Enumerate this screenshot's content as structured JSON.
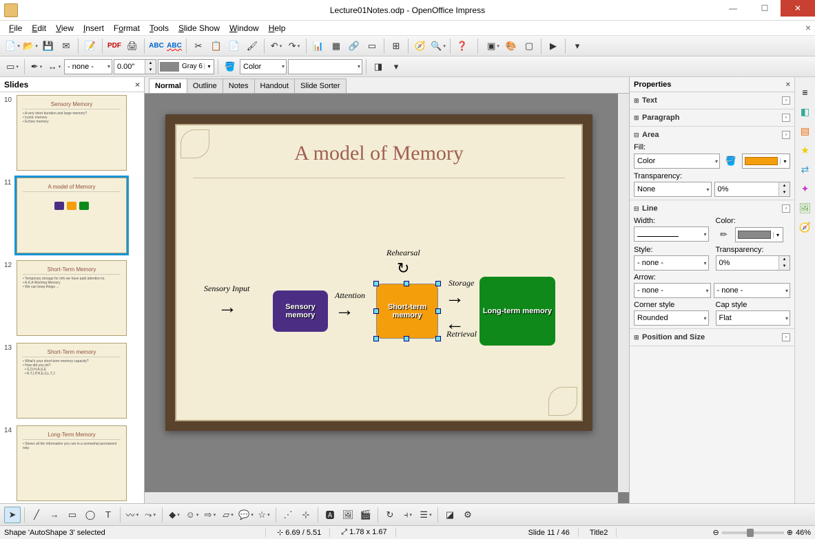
{
  "window": {
    "title": "Lecture01Notes.odp - OpenOffice Impress"
  },
  "menu": [
    "File",
    "Edit",
    "View",
    "Insert",
    "Format",
    "Tools",
    "Slide Show",
    "Window",
    "Help"
  ],
  "toolbar2": {
    "lineStyle": "- none -",
    "lineWidth": "0.00\"",
    "colorName": "Gray 6",
    "fillType": "Color"
  },
  "slidesPanel": {
    "title": "Slides",
    "items": [
      {
        "num": "10",
        "title": "Sensory Memory"
      },
      {
        "num": "11",
        "title": "A model of Memory"
      },
      {
        "num": "12",
        "title": "Short-Term Memory"
      },
      {
        "num": "13",
        "title": "Short-Term memory"
      },
      {
        "num": "14",
        "title": "Long-Term Memory"
      }
    ],
    "selected": 1
  },
  "viewTabs": [
    "Normal",
    "Outline",
    "Notes",
    "Handout",
    "Slide Sorter"
  ],
  "slide": {
    "title": "A model of Memory",
    "boxes": {
      "purple": "Sensory memory",
      "orange": "Short-term memory",
      "green": "Long-term memory"
    },
    "labels": {
      "input": "Sensory Input",
      "attention": "Attention",
      "rehearsal": "Rehearsal",
      "storage": "Storage",
      "retrieval": "Retrieval"
    }
  },
  "properties": {
    "title": "Properties",
    "sections": {
      "text": "Text",
      "paragraph": "Paragraph",
      "area": {
        "label": "Area",
        "fill": "Fill:",
        "fillType": "Color",
        "transparency": "Transparency:",
        "transType": "None",
        "transValue": "0%"
      },
      "line": {
        "label": "Line",
        "width": "Width:",
        "color": "Color:",
        "style": "Style:",
        "styleVal": "- none -",
        "transparency": "Transparency:",
        "transVal": "0%",
        "arrow": "Arrow:",
        "arrowL": "- none -",
        "arrowR": "- none -",
        "corner": "Corner style",
        "cornerVal": "Rounded",
        "cap": "Cap style",
        "capVal": "Flat"
      },
      "pos": "Position and Size"
    }
  },
  "status": {
    "selection": "Shape 'AutoShape 3' selected",
    "pos": "6.69 / 5.51",
    "size": "1.78 x 1.67",
    "slide": "Slide 11 / 46",
    "master": "Title2",
    "zoom": "46%"
  }
}
